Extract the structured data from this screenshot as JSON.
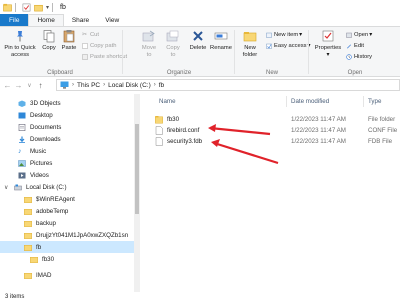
{
  "window": {
    "title": "fb"
  },
  "ribbon_tabs": {
    "file": "File",
    "home": "Home",
    "share": "Share",
    "view": "View"
  },
  "clipboard": {
    "pin": "Pin to Quick access",
    "copy": "Copy",
    "paste": "Paste",
    "cut": "Cut",
    "copy_path": "Copy path",
    "paste_shortcut": "Paste shortcut",
    "label": "Clipboard"
  },
  "organize": {
    "move_to": "Move to",
    "copy_to": "Copy to",
    "delete": "Delete",
    "rename": "Rename",
    "label": "Organize"
  },
  "new_group": {
    "new_folder": "New folder",
    "new_item": "New item",
    "easy_access": "Easy access",
    "label": "New"
  },
  "open_group": {
    "properties": "Properties",
    "open": "Open",
    "edit": "Edit",
    "history": "History",
    "label": "Open"
  },
  "address": {
    "crumbs": [
      "This PC",
      "Local Disk (C:)",
      "fb"
    ]
  },
  "nav": {
    "items": [
      "3D Objects",
      "Desktop",
      "Documents",
      "Downloads",
      "Music",
      "Pictures",
      "Videos",
      "Local Disk (C:)",
      "$WinREAgent",
      "adobeTemp",
      "backup",
      "DrujjzYt041M1JpA0xwZXQZb1sn",
      "fb",
      "fb30",
      "IMAD"
    ]
  },
  "columns": {
    "name": "Name",
    "date": "Date modified",
    "type": "Type"
  },
  "files": [
    {
      "name": "fb30",
      "date": "1/22/2023 11:47 AM",
      "type": "File folder"
    },
    {
      "name": "firebird.conf",
      "date": "1/22/2023 11:47 AM",
      "type": "CONF File"
    },
    {
      "name": "security3.fdb",
      "date": "1/22/2023 11:47 AM",
      "type": "FDB File"
    }
  ],
  "status": {
    "count": "3 items"
  },
  "colors": {
    "accent": "#1979ca",
    "selection": "#cce8ff",
    "arrow": "#e0222a",
    "folder": "#f8d775"
  }
}
